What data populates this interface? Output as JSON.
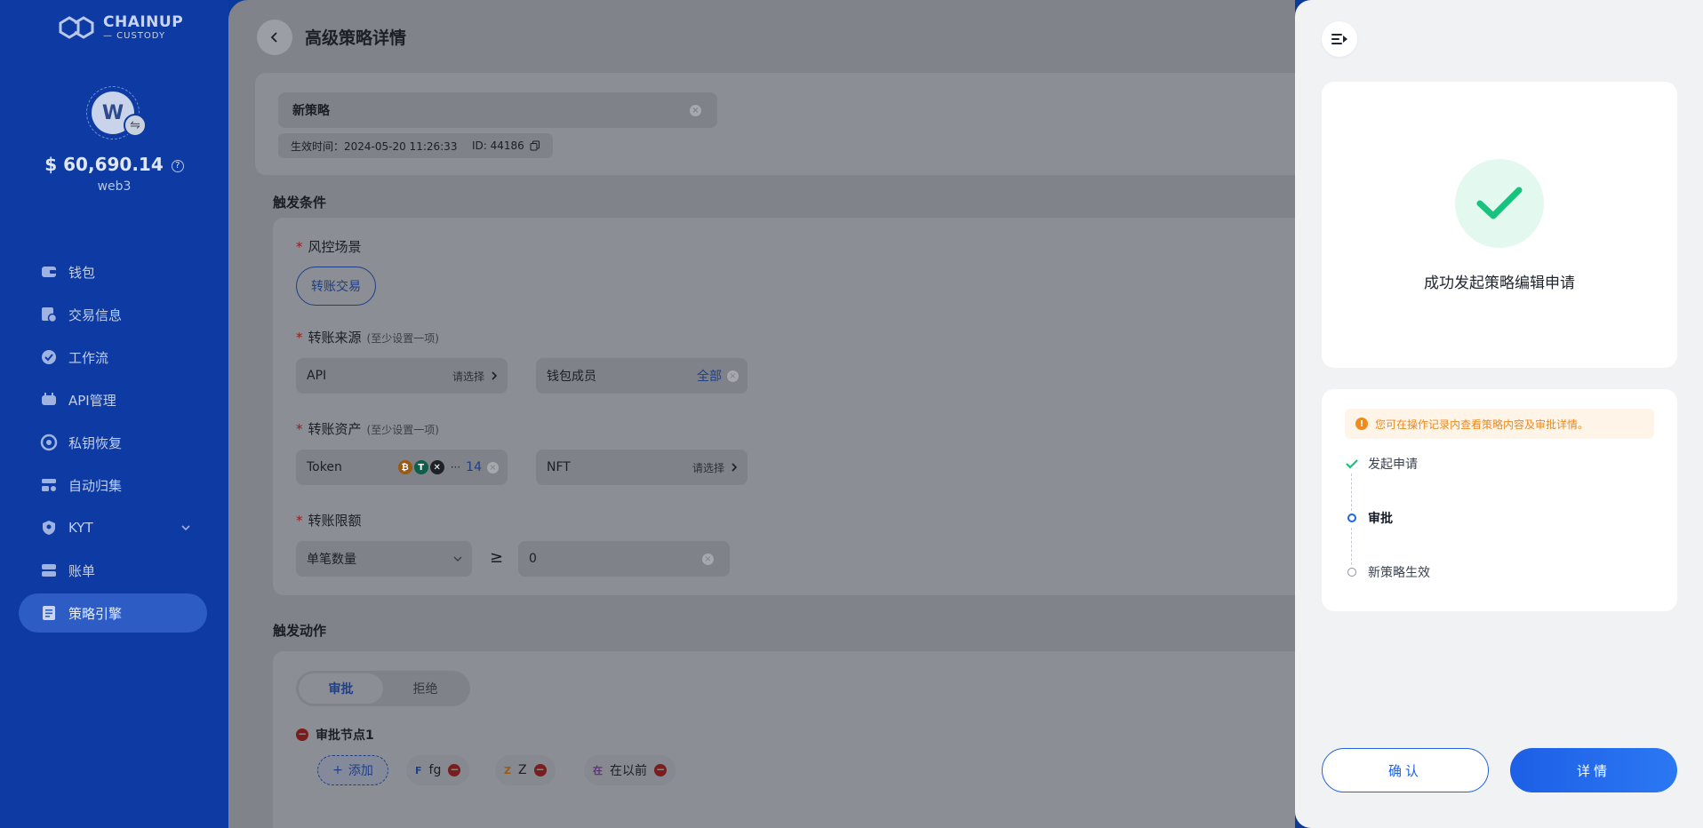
{
  "sidebar": {
    "logo": {
      "line1": "CHAINUP",
      "line2": "— CUSTODY"
    },
    "avatar_initial": "W",
    "balance": "$ 60,690.14",
    "account": "web3",
    "items": [
      {
        "label": "钱包",
        "icon": "wallet-icon"
      },
      {
        "label": "交易信息",
        "icon": "transaction-icon"
      },
      {
        "label": "工作流",
        "icon": "workflow-icon"
      },
      {
        "label": "API管理",
        "icon": "api-icon"
      },
      {
        "label": "私钥恢复",
        "icon": "key-recovery-icon"
      },
      {
        "label": "自动归集",
        "icon": "auto-collect-icon"
      },
      {
        "label": "KYT",
        "icon": "shield-icon"
      },
      {
        "label": "账单",
        "icon": "bill-icon"
      },
      {
        "label": "策略引擎",
        "icon": "policy-icon"
      }
    ],
    "active_item": "策略引擎"
  },
  "main": {
    "title": "高级策略详情",
    "policy_name": "新策略",
    "effective_time": "生效时间：2024-05-20 11:26:33",
    "policy_id": "ID: 44186",
    "trigger_condition_title": "触发条件",
    "risk_scene_label": "风控场景",
    "risk_scene_value": "转账交易",
    "source_label": "转账来源",
    "at_least_one": "(至少设置一项)",
    "source_api": "API",
    "please_select": "请选择",
    "source_member": "钱包成员",
    "all": "全部",
    "asset_label": "转账资产",
    "asset_token": "Token",
    "token_count": "14",
    "asset_nft": "NFT",
    "limit_label": "转账限额",
    "limit_type": "单笔数量",
    "operator": "≥",
    "limit_value": "0",
    "trigger_action_title": "触发动作",
    "action_approve": "审批",
    "action_reject": "拒绝",
    "node_title": "审批节点1",
    "add_label": "添加",
    "members": [
      {
        "initial": "F",
        "name": "fg",
        "color": "#1f3f86"
      },
      {
        "initial": "Z",
        "name": "Z",
        "color": "#9a5a12"
      },
      {
        "initial": "在",
        "name": "在以前",
        "color": "#6a2b86"
      }
    ]
  },
  "drawer": {
    "success_text": "成功发起策略编辑申请",
    "notice": "您可在操作记录内查看策略内容及审批详情。",
    "steps": [
      {
        "label": "发起申请",
        "state": "done"
      },
      {
        "label": "审批",
        "state": "current"
      },
      {
        "label": "新策略生效",
        "state": "pending"
      }
    ],
    "confirm_label": "确认",
    "detail_label": "详情"
  },
  "colors": {
    "sidebar_bg": "#0d3ba3",
    "primary": "#1f62e6",
    "success": "#19c37d",
    "warning": "#f08a1c"
  }
}
